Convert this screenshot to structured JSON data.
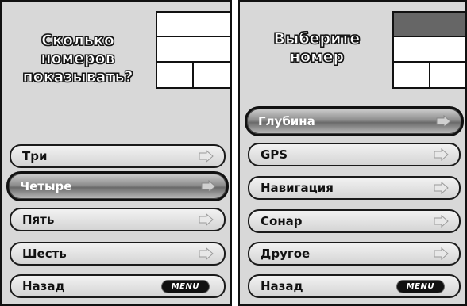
{
  "left_screen": {
    "prompt_lines": [
      "Сколько",
      "номеров",
      "показывать?"
    ],
    "items": [
      {
        "label": "Три",
        "selected": false,
        "icon": "chevron-right-icon"
      },
      {
        "label": "Четыре",
        "selected": true,
        "icon": "chevron-right-icon"
      },
      {
        "label": "Пять",
        "selected": false,
        "icon": "chevron-right-icon"
      },
      {
        "label": "Шесть",
        "selected": false,
        "icon": "chevron-right-icon"
      }
    ],
    "back": {
      "label": "Назад",
      "button": "MENU"
    }
  },
  "right_screen": {
    "prompt_lines": [
      "Выберите",
      "номер"
    ],
    "items": [
      {
        "label": "Глубина",
        "selected": true,
        "icon": "chevron-right-icon"
      },
      {
        "label": "GPS",
        "selected": false,
        "icon": "chevron-right-icon"
      },
      {
        "label": "Навигация",
        "selected": false,
        "icon": "chevron-right-icon"
      },
      {
        "label": "Сонар",
        "selected": false,
        "icon": "chevron-right-icon"
      },
      {
        "label": "Другое",
        "selected": false,
        "icon": "chevron-right-icon"
      }
    ],
    "back": {
      "label": "Назад",
      "button": "MENU"
    }
  },
  "colors": {
    "panel": "#d8d8d8",
    "highlight_cell": "#666666"
  }
}
